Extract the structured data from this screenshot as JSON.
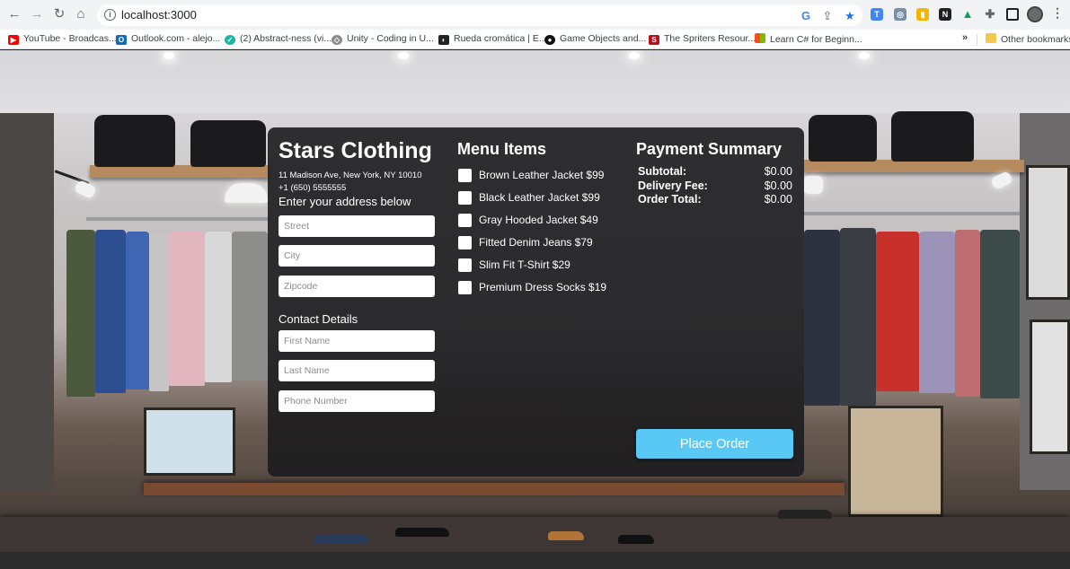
{
  "browser": {
    "url": "localhost:3000",
    "bookmarks": [
      {
        "label": "YouTube - Broadcas...",
        "icon": "youtube-icon",
        "color": "#ff0000"
      },
      {
        "label": "Outlook.com - alejo...",
        "icon": "outlook-icon",
        "color": "#0f6cbd"
      },
      {
        "label": "(2) Abstract-ness (vi...",
        "icon": "vimeo-check-icon",
        "color": "#1ab7a7"
      },
      {
        "label": "Unity - Coding in U...",
        "icon": "unity-icon",
        "color": "#8a8a8a"
      },
      {
        "label": "Rueda cromática | E...",
        "icon": "color-wheel-icon",
        "color": "#222222"
      },
      {
        "label": "Game Objects and...",
        "icon": "paw-icon",
        "color": "#111111"
      },
      {
        "label": "The Spriters Resour...",
        "icon": "spriters-icon",
        "color": "#b5121b"
      },
      {
        "label": "Learn C# for Beginn...",
        "icon": "microsoft-icon",
        "color": "#f25022"
      }
    ],
    "more_bookmarks": "»",
    "other_bookmarks": "Other bookmarks"
  },
  "store": {
    "name": "Stars Clothing",
    "address": "11 Madison Ave, New York, NY 10010",
    "phone": "+1 (650) 5555555",
    "address_prompt": "Enter your address below",
    "street_placeholder": "Street",
    "city_placeholder": "City",
    "zipcode_placeholder": "Zipcode",
    "contact_heading": "Contact Details",
    "first_name_placeholder": "First Name",
    "last_name_placeholder": "Last Name",
    "phone_placeholder": "Phone Number"
  },
  "menu": {
    "title": "Menu Items",
    "items": [
      {
        "label": "Brown Leather Jacket $99",
        "checked": false
      },
      {
        "label": "Black Leather Jacket $99",
        "checked": false
      },
      {
        "label": "Gray Hooded Jacket $49",
        "checked": false
      },
      {
        "label": "Fitted Denim Jeans $79",
        "checked": false
      },
      {
        "label": "Slim Fit T-Shirt $29",
        "checked": false
      },
      {
        "label": "Premium Dress Socks $19",
        "checked": false
      }
    ]
  },
  "payment": {
    "title": "Payment Summary",
    "subtotal_label": "Subtotal:",
    "subtotal_value": "$0.00",
    "delivery_label": "Delivery Fee:",
    "delivery_value": "$0.00",
    "total_label": "Order Total:",
    "total_value": "$0.00",
    "place_order_label": "Place Order"
  },
  "colors": {
    "accent": "#5ac8f5",
    "panel": "#1c1c1e"
  }
}
